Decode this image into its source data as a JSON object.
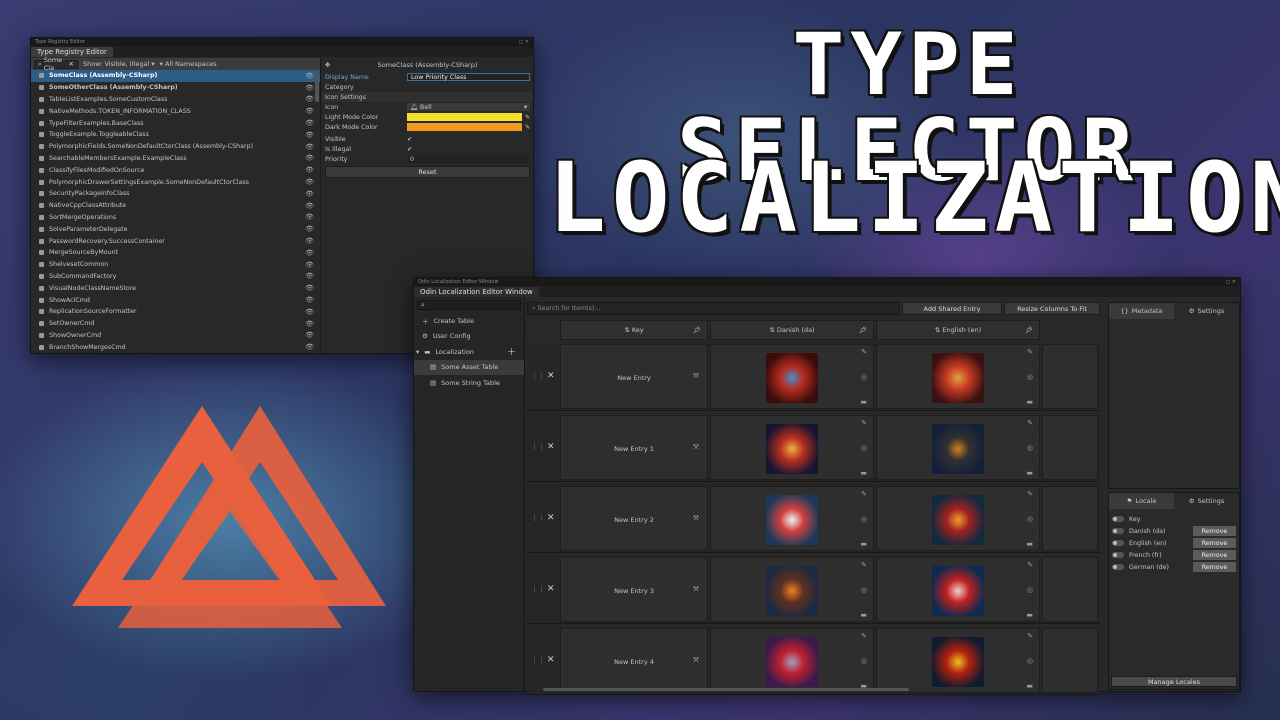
{
  "headline": {
    "line1": "TYPE SELECTOR",
    "line2": "LOCALIZATION"
  },
  "colors": {
    "brand_orange": "#e8603d",
    "selection_blue": "#2c5d87",
    "light_mode_color": "#f5e12a",
    "dark_mode_color": "#ef9a1c"
  },
  "type_registry": {
    "window_title": "Type Registry Editor",
    "tab_label": "Type Registry Editor",
    "search_value": "Some Cla",
    "filter_label": "Show: Visible, Illegal",
    "namespace_label": "All Namespaces",
    "items": [
      {
        "label": "SomeClass (Assembly-CSharp)",
        "selected": true,
        "bold": true
      },
      {
        "label": "SomeOtherClass (Assembly-CSharp)",
        "bold": true
      },
      {
        "label": "TableListExamples.SomeCustomClass"
      },
      {
        "label": "NativeMethods.TOKEN_INFORMATION_CLASS"
      },
      {
        "label": "TypeFilterExamples.BaseClass"
      },
      {
        "label": "ToggleExample.ToggleableClass"
      },
      {
        "label": "PolymorphicFields.SomeNonDefaultCtorClass (Assembly-CSharp)"
      },
      {
        "label": "SearchableMembersExample.ExampleClass"
      },
      {
        "label": "ClassifyFilesModifiedOnSource"
      },
      {
        "label": "PolymorphicDrawerSettingsExample.SomeNonDefaultCtorClass"
      },
      {
        "label": "SecurityPackageInfoClass"
      },
      {
        "label": "NativeCppClassAttribute"
      },
      {
        "label": "SortMergeOperations"
      },
      {
        "label": "SolveParameterDelegate"
      },
      {
        "label": "PasswordRecovery.SuccessContainer"
      },
      {
        "label": "MergeSourceByMount"
      },
      {
        "label": "ShelvesetCommon"
      },
      {
        "label": "SubCommandFactory"
      },
      {
        "label": "VisualNodeClassNameStore"
      },
      {
        "label": "ShowAclCmd"
      },
      {
        "label": "ReplicationSourceFormatter"
      },
      {
        "label": "SetOwnerCmd"
      },
      {
        "label": "ShowOwnerCmd"
      },
      {
        "label": "BranchShowMergesCmd"
      }
    ],
    "inspector": {
      "header": "SomeClass (Assembly-CSharp)",
      "display_name_label": "Display Name",
      "display_name_value": "Low Priority Class",
      "category_label": "Category",
      "icon_settings_label": "Icon Settings",
      "icon_label": "Icon",
      "icon_value": "Bell",
      "light_mode_label": "Light Mode Color",
      "dark_mode_label": "Dark Mode Color",
      "visible_label": "Visible",
      "illegal_label": "Is Illegal",
      "priority_label": "Priority",
      "priority_value": "0",
      "reset_label": "Reset"
    }
  },
  "localization": {
    "window_title": "Odin Localization Editor Window",
    "tab_label": "Odin Localization Editor Window",
    "sidebar": {
      "create_table": "Create Table",
      "user_config": "User Config",
      "localization": "Localization",
      "asset_table": "Some Asset Table",
      "string_table": "Some String Table"
    },
    "search_placeholder": "Search for Item(s)...",
    "add_shared_entry": "Add Shared Entry",
    "resize_columns": "Resize Columns To Fit",
    "columns": {
      "key": "Key",
      "danish": "Danish (da)",
      "english": "English (en)"
    },
    "entries": [
      {
        "key": "New Entry",
        "da_icon": "bracelet-icon",
        "en_icon": "knight-helmet-icon"
      },
      {
        "key": "New Entry 1",
        "da_icon": "gauntlet-icon",
        "en_icon": "shield-icon"
      },
      {
        "key": "New Entry 2",
        "da_icon": "magic-staff-icon",
        "en_icon": "spell-book-icon"
      },
      {
        "key": "New Entry 3",
        "da_icon": "armor-helmet-icon",
        "en_icon": "amulet-icon"
      },
      {
        "key": "New Entry 4",
        "da_icon": "red-helmet-icon",
        "en_icon": "cape-icon"
      }
    ],
    "metadata_tab": "Metadata",
    "settings_tab": "Settings",
    "locale_tab": "Locale",
    "locales": [
      {
        "name": "Key",
        "removable": false
      },
      {
        "name": "Danish (da)",
        "removable": true
      },
      {
        "name": "English (en)",
        "removable": true
      },
      {
        "name": "French (fr)",
        "removable": true
      },
      {
        "name": "German (de)",
        "removable": true
      }
    ],
    "remove_label": "Remove",
    "manage_locales": "Manage Locales"
  }
}
